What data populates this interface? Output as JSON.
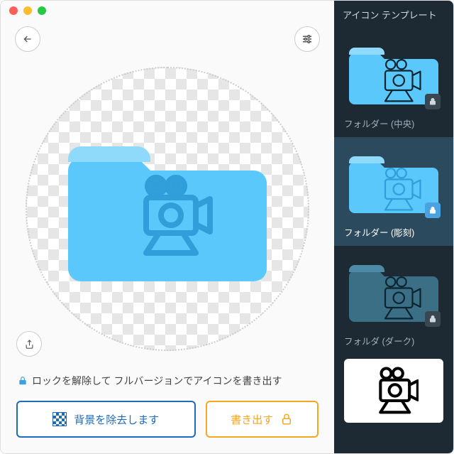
{
  "sidebar": {
    "title": "アイコン テンプレート",
    "templates": [
      {
        "label": "フォルダー (中央)",
        "locked": true,
        "selected": false
      },
      {
        "label": "フォルダー (彫刻)",
        "locked": true,
        "selected": true
      },
      {
        "label": "フォルダ (ダーク)",
        "locked": true,
        "selected": false
      }
    ]
  },
  "lock_message": "ロックを解除して フルバージョンでアイコンを書き出す",
  "actions": {
    "remove_bg": "背景を除去します",
    "export": "書き出す"
  },
  "colors": {
    "folder": "#5ac8fa",
    "folder_tab": "#8fd9fb",
    "accent_blue": "#1e6abf",
    "accent_orange": "#f5a623",
    "sidebar_bg": "#1e2a33"
  }
}
